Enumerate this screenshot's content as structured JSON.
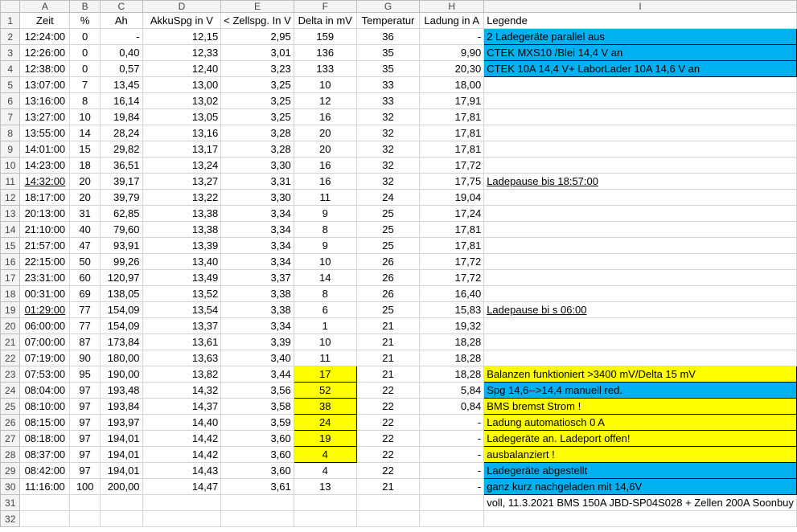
{
  "columns": [
    "A",
    "B",
    "C",
    "D",
    "E",
    "F",
    "G",
    "H",
    "I"
  ],
  "headers": [
    "Zeit",
    "%",
    "Ah",
    "AkkuSpg in V",
    "< Zellspg. In V",
    "Delta in mV",
    "Temperatur",
    "Ladung in A",
    "Legende"
  ],
  "rows": [
    [
      "12:24:00",
      "0",
      "-",
      "12,15",
      "2,95",
      "159",
      "36",
      "-",
      "2 Ladegeräte parallel aus"
    ],
    [
      "12:26:00",
      "0",
      "0,40",
      "12,33",
      "3,01",
      "136",
      "35",
      "9,90",
      "CTEK MXS10 /Blei 14,4 V an"
    ],
    [
      "12:38:00",
      "0",
      "0,57",
      "12,40",
      "3,23",
      "133",
      "35",
      "20,30",
      "CTEK 10A  14,4 V+ LaborLader 10A 14,6 V an"
    ],
    [
      "13:07:00",
      "7",
      "13,45",
      "13,00",
      "3,25",
      "10",
      "33",
      "18,00",
      ""
    ],
    [
      "13:16:00",
      "8",
      "16,14",
      "13,02",
      "3,25",
      "12",
      "33",
      "17,91",
      ""
    ],
    [
      "13:27:00",
      "10",
      "19,84",
      "13,05",
      "3,25",
      "16",
      "32",
      "17,81",
      ""
    ],
    [
      "13:55:00",
      "14",
      "28,24",
      "13,16",
      "3,28",
      "20",
      "32",
      "17,81",
      ""
    ],
    [
      "14:01:00",
      "15",
      "29,82",
      "13,17",
      "3,28",
      "20",
      "32",
      "17,81",
      ""
    ],
    [
      "14:23:00",
      "18",
      "36,51",
      "13,24",
      "3,30",
      "16",
      "32",
      "17,72",
      ""
    ],
    [
      "14:32:00",
      "20",
      "39,17",
      "13,27",
      "3,31",
      "16",
      "32",
      "17,75",
      "Ladepause bis 18:57:00"
    ],
    [
      "18:17:00",
      "20",
      "39,79",
      "13,22",
      "3,30",
      "11",
      "24",
      "19,04",
      ""
    ],
    [
      "20:13:00",
      "31",
      "62,85",
      "13,38",
      "3,34",
      "9",
      "25",
      "17,24",
      ""
    ],
    [
      "21:10:00",
      "40",
      "79,60",
      "13,38",
      "3,34",
      "8",
      "25",
      "17,81",
      ""
    ],
    [
      "21:57:00",
      "47",
      "93,91",
      "13,39",
      "3,34",
      "9",
      "25",
      "17,81",
      ""
    ],
    [
      "22:15:00",
      "50",
      "99,26",
      "13,40",
      "3,34",
      "10",
      "26",
      "17,72",
      ""
    ],
    [
      "23:31:00",
      "60",
      "120,97",
      "13,49",
      "3,37",
      "14",
      "26",
      "17,72",
      ""
    ],
    [
      "00:31:00",
      "69",
      "138,05",
      "13,52",
      "3,38",
      "8",
      "26",
      "16,40",
      ""
    ],
    [
      "01:29:00",
      "77",
      "154,09",
      "13,54",
      "3,38",
      "6",
      "25",
      "15,83",
      "Ladepause bi s 06:00"
    ],
    [
      "06:00:00",
      "77",
      "154,09",
      "13,37",
      "3,34",
      "1",
      "21",
      "19,32",
      ""
    ],
    [
      "07:00:00",
      "87",
      "173,84",
      "13,61",
      "3,39",
      "10",
      "21",
      "18,28",
      ""
    ],
    [
      "07:19:00",
      "90",
      "180,00",
      "13,63",
      "3,40",
      "11",
      "21",
      "18,28",
      ""
    ],
    [
      "07:53:00",
      "95",
      "190,00",
      "13,82",
      "3,44",
      "17",
      "21",
      "18,28",
      "Balanzen  funktioniert >3400 mV/Delta 15 mV"
    ],
    [
      "08:04:00",
      "97",
      "193,48",
      "14,32",
      "3,56",
      "52",
      "22",
      "5,84",
      "Spg 14,6-->14,4 manuell red."
    ],
    [
      "08:10:00",
      "97",
      "193,84",
      "14,37",
      "3,58",
      "38",
      "22",
      "0,84",
      "BMS bremst Strom !"
    ],
    [
      "08:15:00",
      "97",
      "193,97",
      "14,40",
      "3,59",
      "24",
      "22",
      "-",
      "Ladung automatiosch 0 A"
    ],
    [
      "08:18:00",
      "97",
      "194,01",
      "14,42",
      "3,60",
      "19",
      "22",
      "-",
      "Ladegeräte an. Ladeport offen!"
    ],
    [
      "08:37:00",
      "97",
      "194,01",
      "14,42",
      "3,60",
      "4",
      "22",
      "-",
      "ausbalanziert !"
    ],
    [
      "08:42:00",
      "97",
      "194,01",
      "14,43",
      "3,60",
      "4",
      "22",
      "-",
      "Ladegeräte abgestellt"
    ],
    [
      "11:16:00",
      "100",
      "200,00",
      "14,47",
      "3,61",
      "13",
      "21",
      "-",
      "ganz kurz nachgeladen mit 14,6V"
    ],
    [
      "",
      "",
      "",
      "",
      "",
      "",
      "",
      "",
      "voll, 11.3.2021 BMS 150A JBD-SP04S028 + Zellen 200A Soonbuy"
    ],
    [
      "",
      "",
      "",
      "",
      "",
      "",
      "",
      "",
      ""
    ]
  ],
  "colors": {
    "yellow": "#ffff00",
    "blue": "#00b0f0",
    "grid": "#d4d4d4",
    "header_bg": "#f3f3f3"
  }
}
